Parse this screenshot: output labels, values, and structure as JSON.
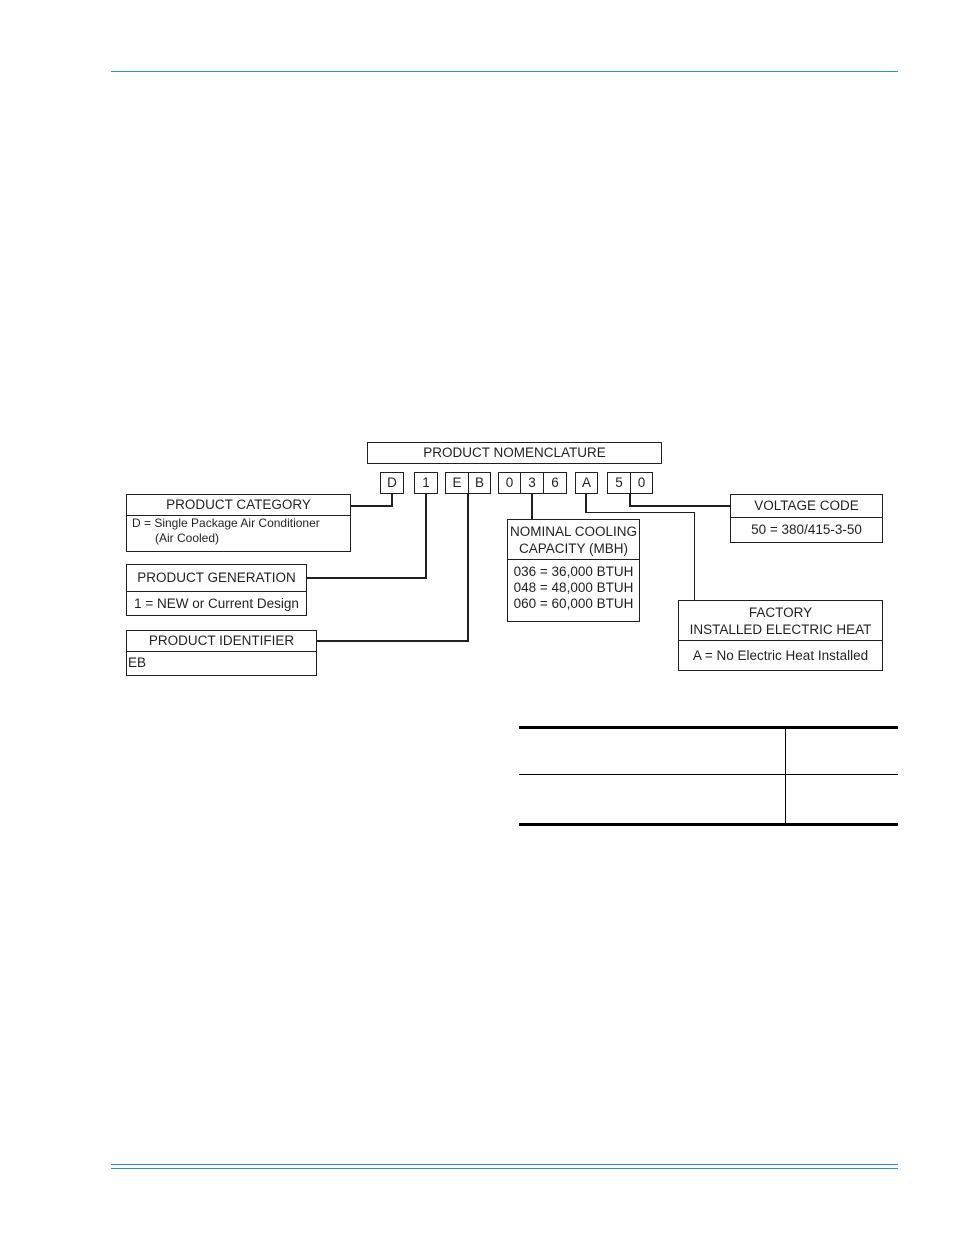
{
  "diagram": {
    "title": "PRODUCT NOMENCLATURE",
    "code_characters": [
      "D",
      "1",
      "E",
      "B",
      "0",
      "3",
      "6",
      "A",
      "5",
      "0"
    ],
    "fields": {
      "product_category": {
        "title": "PRODUCT CATEGORY",
        "lines": [
          "D = Single Package Air Conditioner",
          "(Air Cooled)"
        ]
      },
      "product_generation": {
        "title": "PRODUCT GENERATION",
        "lines": [
          "1 = NEW or Current Design"
        ]
      },
      "product_identifier": {
        "title": "PRODUCT IDENTIFIER",
        "lines": [
          "EB"
        ]
      },
      "nominal_cooling_capacity": {
        "title_lines": [
          "NOMINAL COOLING",
          "CAPACITY (MBH)"
        ],
        "lines": [
          "036 = 36,000 BTUH",
          "048 = 48,000 BTUH",
          "060 = 60,000 BTUH"
        ]
      },
      "factory_installed_electric_heat": {
        "title_lines": [
          "FACTORY",
          "INSTALLED ELECTRIC HEAT"
        ],
        "lines": [
          "A = No Electric Heat Installed"
        ]
      },
      "voltage_code": {
        "title": "VOLTAGE CODE",
        "lines": [
          "50 = 380/415-3-50"
        ]
      }
    }
  },
  "colors": {
    "rule": "#2b8de0",
    "ink": "#231f20"
  }
}
